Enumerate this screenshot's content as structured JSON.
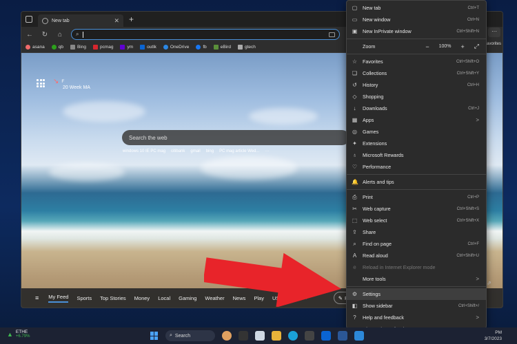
{
  "browser": {
    "tab_title": "New tab",
    "address_value": "",
    "favorites": [
      "asana",
      "qb",
      "Bing",
      "pcmag",
      "ym",
      "outlk",
      "OneDrive",
      "fb",
      "eBird",
      "gtech"
    ],
    "favorites_label": "avorites"
  },
  "newtab": {
    "weather_unit": "F",
    "weather_label": "20 Week MA",
    "search_placeholder": "Search the web",
    "quicklinks": [
      "windows 10 IE PC mag",
      "citibank",
      "gmail",
      "bing",
      "PC mag article Wed...",
      "···"
    ],
    "news_items": [
      "My Feed",
      "Sports",
      "Top Stories",
      "Money",
      "Local",
      "Gaming",
      "Weather",
      "News",
      "Play",
      "US News",
      "···"
    ],
    "news_pill": "Pe"
  },
  "menu": {
    "items": [
      {
        "icon": "▢",
        "label": "New tab",
        "shortcut": "Ctrl+T"
      },
      {
        "icon": "▭",
        "label": "New window",
        "shortcut": "Ctrl+N"
      },
      {
        "icon": "▣",
        "label": "New InPrivate window",
        "shortcut": "Ctrl+Shift+N"
      }
    ],
    "zoom": {
      "label": "Zoom",
      "value": "100%"
    },
    "items2": [
      {
        "icon": "☆",
        "label": "Favorites",
        "shortcut": "Ctrl+Shift+O"
      },
      {
        "icon": "❏",
        "label": "Collections",
        "shortcut": "Ctrl+Shift+Y"
      },
      {
        "icon": "↺",
        "label": "History",
        "shortcut": "Ctrl+H"
      },
      {
        "icon": "◇",
        "label": "Shopping",
        "shortcut": ""
      },
      {
        "icon": "↓",
        "label": "Downloads",
        "shortcut": "Ctrl+J"
      },
      {
        "icon": "▦",
        "label": "Apps",
        "shortcut": "",
        "arrow": ">"
      },
      {
        "icon": "◎",
        "label": "Games",
        "shortcut": ""
      },
      {
        "icon": "✦",
        "label": "Extensions",
        "shortcut": ""
      },
      {
        "icon": "♁",
        "label": "Microsoft Rewards",
        "shortcut": ""
      },
      {
        "icon": "♡",
        "label": "Performance",
        "shortcut": ""
      }
    ],
    "items3": [
      {
        "icon": "🔔",
        "label": "Alerts and tips",
        "shortcut": ""
      }
    ],
    "items4": [
      {
        "icon": "⎙",
        "label": "Print",
        "shortcut": "Ctrl+P"
      },
      {
        "icon": "✂",
        "label": "Web capture",
        "shortcut": "Ctrl+Shift+S"
      },
      {
        "icon": "⬚",
        "label": "Web select",
        "shortcut": "Ctrl+Shift+X"
      },
      {
        "icon": "⇪",
        "label": "Share",
        "shortcut": ""
      },
      {
        "icon": "⌕",
        "label": "Find on page",
        "shortcut": "Ctrl+F"
      },
      {
        "icon": "A",
        "label": "Read aloud",
        "shortcut": "Ctrl+Shift+U"
      },
      {
        "icon": "e",
        "label": "Reload in Internet Explorer mode",
        "shortcut": "",
        "disabled": true
      },
      {
        "icon": "",
        "label": "More tools",
        "shortcut": "",
        "arrow": ">"
      }
    ],
    "items5": [
      {
        "icon": "⚙",
        "label": "Settings",
        "shortcut": "",
        "selected": true
      },
      {
        "icon": "◧",
        "label": "Show sidebar",
        "shortcut": "Ctrl+Shift+/"
      },
      {
        "icon": "?",
        "label": "Help and feedback",
        "shortcut": "",
        "arrow": ">"
      },
      {
        "icon": "",
        "label": "Close Microsoft Edge",
        "shortcut": ""
      }
    ]
  },
  "taskbar": {
    "stock_name": "ETHE",
    "stock_change": "+6.79%",
    "search_label": "Search",
    "time": "PM",
    "date": "3/7/2023"
  }
}
